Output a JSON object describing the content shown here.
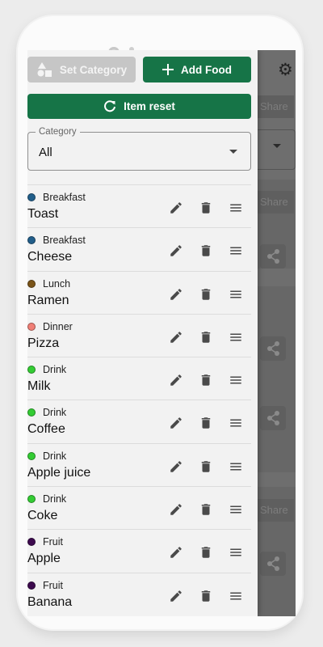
{
  "toolbar": {
    "set_category_label": "Set Category",
    "add_food_label": "Add Food",
    "item_reset_label": "Item reset"
  },
  "category_select": {
    "legend": "Category",
    "value": "All"
  },
  "background": {
    "share_label": "Share"
  },
  "items": [
    {
      "category": "Breakfast",
      "name": "Toast",
      "color": "#215e8a"
    },
    {
      "category": "Breakfast",
      "name": "Cheese",
      "color": "#215e8a"
    },
    {
      "category": "Lunch",
      "name": "Ramen",
      "color": "#7a5418"
    },
    {
      "category": "Dinner",
      "name": "Pizza",
      "color": "#f07f76"
    },
    {
      "category": "Drink",
      "name": "Milk",
      "color": "#33cc33"
    },
    {
      "category": "Drink",
      "name": "Coffee",
      "color": "#33cc33"
    },
    {
      "category": "Drink",
      "name": "Apple juice",
      "color": "#33cc33"
    },
    {
      "category": "Drink",
      "name": "Coke",
      "color": "#33cc33"
    },
    {
      "category": "Fruit",
      "name": "Apple",
      "color": "#3d0a4e"
    },
    {
      "category": "Fruit",
      "name": "Banana",
      "color": "#3d0a4e"
    }
  ],
  "colors": {
    "primary": "#167447",
    "disabled": "#c6c6c6"
  }
}
